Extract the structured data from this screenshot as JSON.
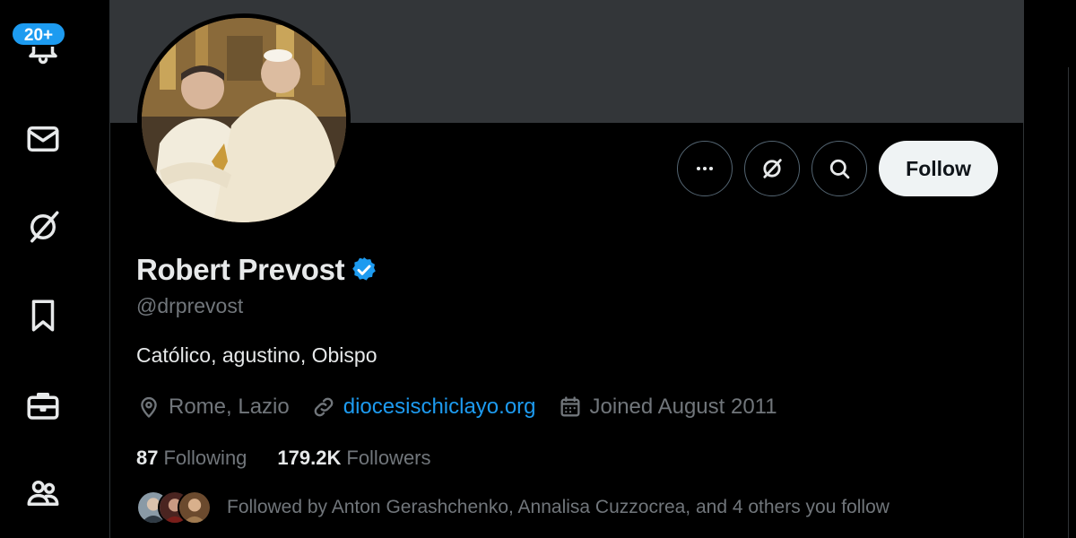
{
  "nav": {
    "notifications_badge": "20+",
    "items": [
      {
        "icon": "bell-icon"
      },
      {
        "icon": "mail-icon"
      },
      {
        "icon": "grok-icon"
      },
      {
        "icon": "bookmark-icon"
      },
      {
        "icon": "briefcase-icon"
      },
      {
        "icon": "communities-icon"
      }
    ]
  },
  "profile": {
    "display_name": "Robert Prevost",
    "handle": "@drprevost",
    "bio": "Católico, agustino, Obispo",
    "location": "Rome, Lazio",
    "website": "diocesischiclayo.org",
    "joined": "Joined August 2011",
    "following_count": "87",
    "following_label": "Following",
    "followers_count": "179.2K",
    "followers_label": "Followers",
    "followed_by": "Followed by Anton Gerashchenko, Annalisa Cuzzocrea, and 4 others you follow"
  },
  "actions": {
    "more_icon": "more-icon",
    "grok_icon": "grok-icon",
    "search_icon": "search-icon",
    "follow_label": "Follow"
  },
  "colors": {
    "accent": "#1d9bf0",
    "background": "#000000",
    "banner": "#333639",
    "muted_text": "#71767b",
    "primary_text": "#e7e9ea"
  }
}
